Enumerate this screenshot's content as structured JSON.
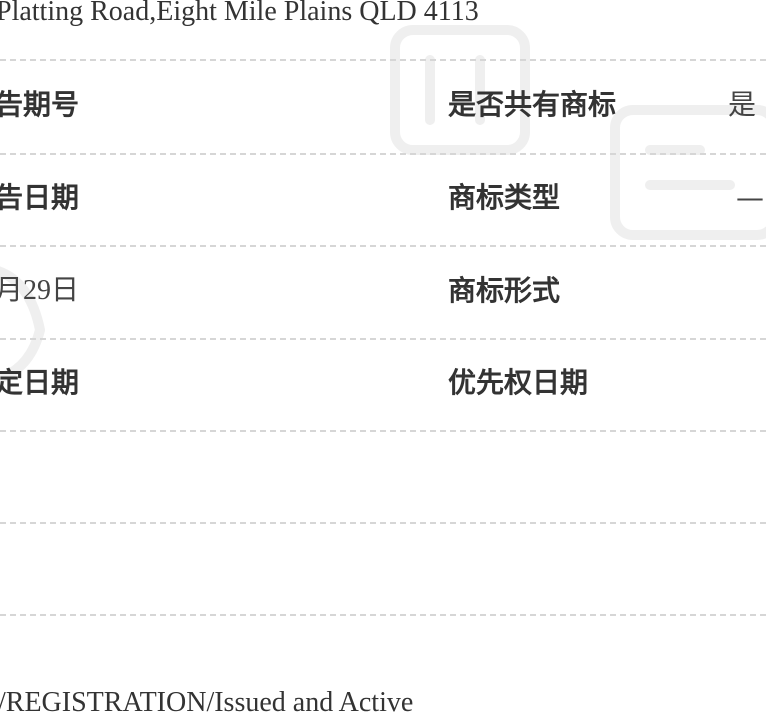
{
  "address_line": "Platting Road,Eight Mile Plains QLD 4113",
  "rows": [
    {
      "left_label": "告期号",
      "right_label": "是否共有商标",
      "right_value": "是"
    },
    {
      "left_label": "告日期",
      "right_label": "商标类型",
      "right_value": "—"
    },
    {
      "left_value": "月29日",
      "right_label": "商标形式",
      "right_value": ""
    },
    {
      "left_label": "定日期",
      "right_label": "优先权日期",
      "right_value": ""
    }
  ],
  "status_line": "/REGISTRATION/Issued and Active"
}
